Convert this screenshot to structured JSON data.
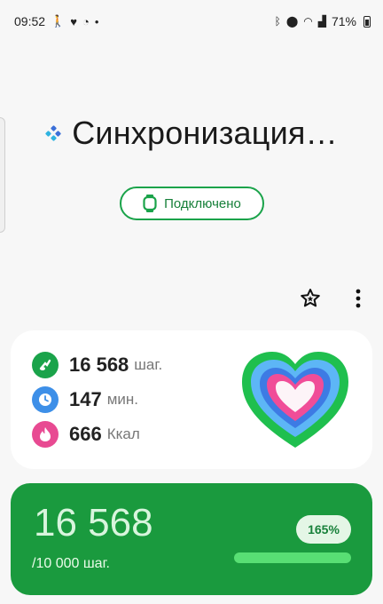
{
  "status_bar": {
    "time": "09:52",
    "battery_percent": "71%",
    "left_icons": [
      "walk-icon",
      "heart-icon",
      "whatsapp-icon",
      "dot-icon"
    ],
    "right_icons": [
      "bluetooth-icon",
      "location-icon",
      "wifi-icon",
      "signal-icon",
      "battery-icon"
    ]
  },
  "header": {
    "title": "Синхронизация…",
    "connection_status": "Подключено"
  },
  "toolbar": {
    "icons": [
      "badge-star-icon",
      "more-vertical-icon"
    ]
  },
  "activity": {
    "steps_value": "16 568",
    "steps_unit": "шаг.",
    "minutes_value": "147",
    "minutes_unit": "мин.",
    "calories_value": "666",
    "calories_unit": "Ккал"
  },
  "steps_card": {
    "steps": "16 568",
    "goal": "/10 000 шаг.",
    "percent": "165%",
    "progress": 1.0
  },
  "colors": {
    "accent_green": "#1a9a3e",
    "steps_icon": "#1aa34a",
    "minutes_icon": "#3d8fe8",
    "calories_icon": "#e84a92"
  }
}
